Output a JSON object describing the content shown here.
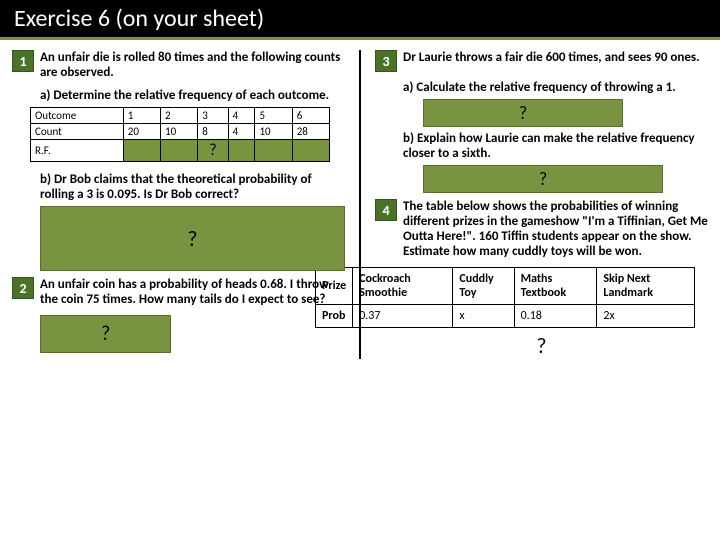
{
  "header": {
    "title": "Exercise 6 (on your sheet)"
  },
  "q1": {
    "num": "1",
    "text": "An unfair die is rolled 80 times and the following counts are observed.",
    "a": "a)   Determine the relative frequency of each outcome.",
    "table": {
      "h": "Outcome",
      "h1": "1",
      "h2": "2",
      "h3": "3",
      "h4": "4",
      "h5": "5",
      "h6": "6",
      "c": "Count",
      "c1": "20",
      "c2": "10",
      "c3": "8",
      "c4": "4",
      "c5": "10",
      "c6": "28",
      "r": "R.F."
    },
    "table_q": "?",
    "b": "b)   Dr Bob claims that the theoretical probability of rolling a 3 is 0.095. Is Dr Bob correct?",
    "b_q": "?"
  },
  "q2": {
    "num": "2",
    "text": "An unfair coin has a probability of heads 0.68. I throw the coin 75 times. How many tails do I expect to see?",
    "q": "?"
  },
  "q3": {
    "num": "3",
    "text": "Dr Laurie throws a fair die 600 times, and sees 90 ones.",
    "a": "a)   Calculate the relative frequency of throwing a 1.",
    "a_q": "?",
    "b": "b)   Explain how Laurie can make the relative frequency closer to a sixth.",
    "b_q": "?"
  },
  "q4": {
    "num": "4",
    "text": "The table below shows the probabilities of winning different prizes in the gameshow \"I'm a Tiffinian, Get Me Outta Here!\". 160 Tiffin students appear on the show. Estimate how many cuddly toys will be won.",
    "table": {
      "h0": "Prize",
      "h1": "Cockroach Smoothie",
      "h2": "Cuddly Toy",
      "h3": "Maths Textbook",
      "h4": "Skip Next Landmark",
      "p0": "Prob",
      "p1": "0.37",
      "p2": "x",
      "p3": "0.18",
      "p4": "2x"
    },
    "q": "?"
  }
}
